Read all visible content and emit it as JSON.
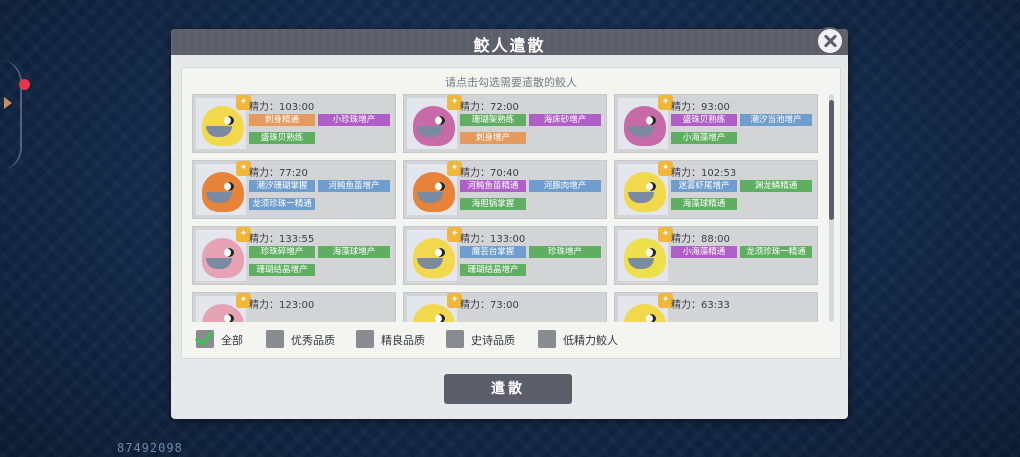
{
  "background": {
    "account_number": "87492098"
  },
  "dialog": {
    "title": "鲛人遣散",
    "instruction": "请点击勾选需要遣散的鲛人",
    "energy_prefix": "精力：",
    "dismiss_label": "遣散",
    "close_icon": "close-icon"
  },
  "tag_colors": {
    "orange": "#e59a5e",
    "purple": "#b05fc8",
    "green": "#5fae62",
    "blue": "#6f9dcd"
  },
  "cards": [
    {
      "energy": "103:00",
      "face": "#f2d84c",
      "tags": [
        {
          "text": "刺身精通",
          "color": "orange"
        },
        {
          "text": "小珍珠增产",
          "color": "purple"
        },
        {
          "text": "盛珠贝熟练",
          "color": "green"
        }
      ]
    },
    {
      "energy": "72:00",
      "face": "#c66aa8",
      "tags": [
        {
          "text": "珊瑚架熟练",
          "color": "green"
        },
        {
          "text": "海床砂增产",
          "color": "purple"
        },
        {
          "text": "刺身增产",
          "color": "orange"
        }
      ]
    },
    {
      "energy": "93:00",
      "face": "#c66aa8",
      "tags": [
        {
          "text": "盛珠贝熟练",
          "color": "purple"
        },
        {
          "text": "潮汐当池增产",
          "color": "blue"
        },
        {
          "text": "小海藻增产",
          "color": "green"
        }
      ]
    },
    {
      "energy": "77:20",
      "face": "#e8833a",
      "tags": [
        {
          "text": "潮汐珊瑚掌握",
          "color": "blue"
        },
        {
          "text": "河鲀鱼苗增产",
          "color": "blue"
        },
        {
          "text": "龙须珍珠一精通",
          "color": "blue"
        }
      ]
    },
    {
      "energy": "70:40",
      "face": "#e8833a",
      "tags": [
        {
          "text": "河鲀鱼苗精通",
          "color": "purple"
        },
        {
          "text": "河豚肉增产",
          "color": "blue"
        },
        {
          "text": "海胆锅掌握",
          "color": "green"
        }
      ]
    },
    {
      "energy": "102:53",
      "face": "#f2d84c",
      "tags": [
        {
          "text": "迷雾虾尾增产",
          "color": "blue"
        },
        {
          "text": "渊龙鳞精通",
          "color": "green"
        },
        {
          "text": "海藻球精通",
          "color": "green"
        }
      ]
    },
    {
      "energy": "133:55",
      "face": "#e6a3b4",
      "tags": [
        {
          "text": "珍珠碎增产",
          "color": "green"
        },
        {
          "text": "海藻球增产",
          "color": "green"
        },
        {
          "text": "珊瑚结晶增产",
          "color": "green"
        }
      ]
    },
    {
      "energy": "133:00",
      "face": "#f2d84c",
      "tags": [
        {
          "text": "魔芸台掌握",
          "color": "blue"
        },
        {
          "text": "珍珠增产",
          "color": "green"
        },
        {
          "text": "珊瑚结晶增产",
          "color": "green"
        }
      ]
    },
    {
      "energy": "88:00",
      "face": "#eedf4c",
      "tags": [
        {
          "text": "小海藻精通",
          "color": "purple"
        },
        {
          "text": "龙须珍珠一精通",
          "color": "green"
        }
      ]
    },
    {
      "energy": "123:00",
      "face": "#e6a3b4",
      "tags": []
    },
    {
      "energy": "73:00",
      "face": "#f2d84c",
      "tags": []
    },
    {
      "energy": "63:33",
      "face": "#f2d84c",
      "tags": []
    }
  ],
  "filters": [
    {
      "label": "全部",
      "checked": true
    },
    {
      "label": "优秀品质",
      "checked": false
    },
    {
      "label": "精良品质",
      "checked": false
    },
    {
      "label": "史诗品质",
      "checked": false
    },
    {
      "label": "低精力鲛人",
      "checked": false
    }
  ]
}
